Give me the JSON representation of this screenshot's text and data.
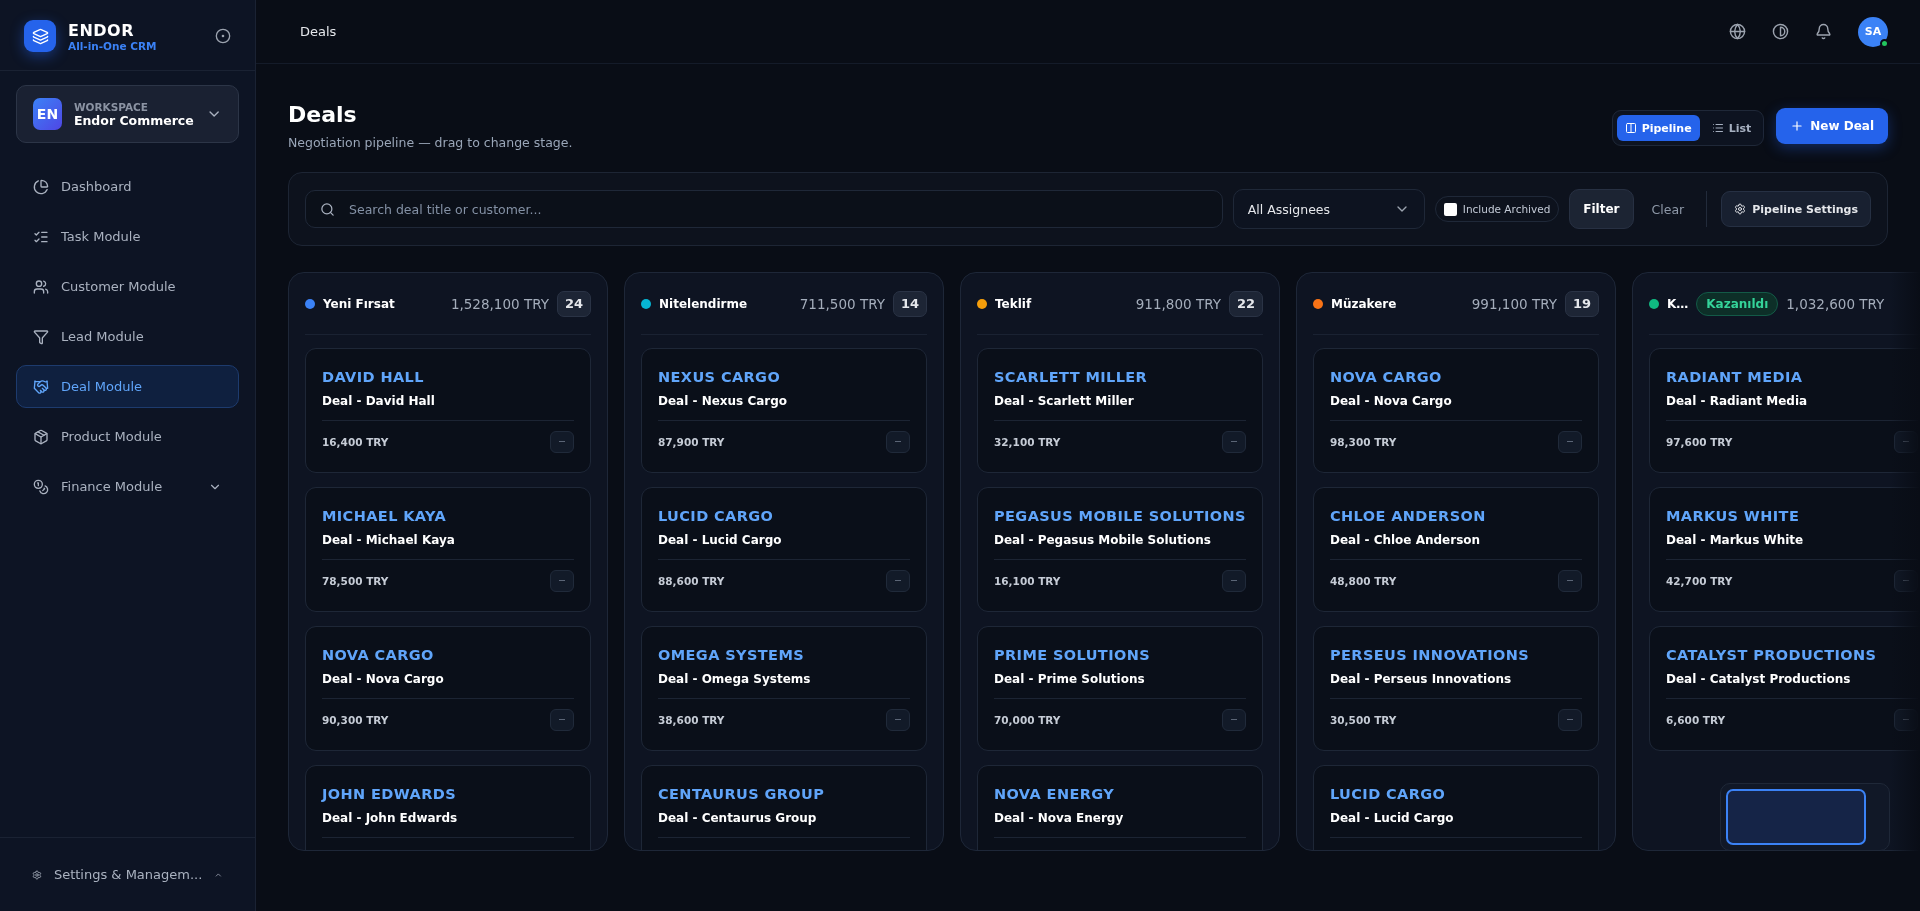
{
  "brand": {
    "name": "ENDOR",
    "tagline": "All-in-One CRM"
  },
  "workspace": {
    "initials": "EN",
    "label": "WORKSPACE",
    "name": "Endor Commerce"
  },
  "sidebar": {
    "items": [
      {
        "label": "Dashboard",
        "kind": "dashboard",
        "selected": false,
        "expandable": false
      },
      {
        "label": "Task Module",
        "kind": "tasks",
        "selected": false,
        "expandable": false
      },
      {
        "label": "Customer Module",
        "kind": "customers",
        "selected": false,
        "expandable": false
      },
      {
        "label": "Lead Module",
        "kind": "leads",
        "selected": false,
        "expandable": false
      },
      {
        "label": "Deal Module",
        "kind": "deals",
        "selected": true,
        "expandable": false
      },
      {
        "label": "Product Module",
        "kind": "products",
        "selected": false,
        "expandable": false
      },
      {
        "label": "Finance Module",
        "kind": "finance",
        "selected": false,
        "expandable": true
      }
    ],
    "footer": "Settings & Managem..."
  },
  "topbar": {
    "breadcrumb": "Deals",
    "avatar": "SA"
  },
  "page": {
    "title": "Deals",
    "subtitle": "Negotiation pipeline — drag to change stage."
  },
  "view_toggle": [
    {
      "label": "Pipeline",
      "kind": "pipeline",
      "selected": true
    },
    {
      "label": "List",
      "kind": "list",
      "selected": false
    }
  ],
  "new_button": "New Deal",
  "filters": {
    "search_placeholder": "Search deal title or customer...",
    "assignee": "All Assignees",
    "include_archived": {
      "label": "Include Archived",
      "checked": false
    },
    "filter": "Filter",
    "clear": "Clear",
    "settings": "Pipeline Settings"
  },
  "columns": [
    {
      "title": "Yeni Fırsat",
      "color": "#3b82f6",
      "total": "1,528,100 TRY",
      "count": "24",
      "cards": [
        {
          "title": "DAVID HALL",
          "deal": "Deal - David Hall",
          "amount": "16,400 TRY"
        },
        {
          "title": "MICHAEL KAYA",
          "deal": "Deal - Michael Kaya",
          "amount": "78,500 TRY"
        },
        {
          "title": "NOVA CARGO",
          "deal": "Deal - Nova Cargo",
          "amount": "90,300 TRY"
        },
        {
          "title": "JOHN EDWARDS",
          "deal": "Deal - John Edwards"
        }
      ]
    },
    {
      "title": "Nitelendirme",
      "color": "#06b6d4",
      "total": "711,500 TRY",
      "count": "14",
      "cards": [
        {
          "title": "NEXUS CARGO",
          "deal": "Deal - Nexus Cargo",
          "amount": "87,900 TRY"
        },
        {
          "title": "LUCID CARGO",
          "deal": "Deal - Lucid Cargo",
          "amount": "88,600 TRY"
        },
        {
          "title": "OMEGA SYSTEMS",
          "deal": "Deal - Omega Systems",
          "amount": "38,600 TRY"
        },
        {
          "title": "CENTAURUS GROUP",
          "deal": "Deal - Centaurus Group"
        }
      ]
    },
    {
      "title": "Teklif",
      "color": "#f59e0b",
      "total": "911,800 TRY",
      "count": "22",
      "cards": [
        {
          "title": "SCARLETT MILLER",
          "deal": "Deal - Scarlett Miller",
          "amount": "32,100 TRY"
        },
        {
          "title": "PEGASUS MOBILE SOLUTIONS",
          "deal": "Deal - Pegasus Mobile Solutions",
          "amount": "16,100 TRY"
        },
        {
          "title": "PRIME SOLUTIONS",
          "deal": "Deal - Prime Solutions",
          "amount": "70,000 TRY"
        },
        {
          "title": "NOVA ENERGY",
          "deal": "Deal - Nova Energy"
        }
      ]
    },
    {
      "title": "Müzakere",
      "color": "#f97316",
      "total": "991,100 TRY",
      "count": "19",
      "cards": [
        {
          "title": "NOVA CARGO",
          "deal": "Deal - Nova Cargo",
          "amount": "98,300 TRY"
        },
        {
          "title": "CHLOE ANDERSON",
          "deal": "Deal - Chloe Anderson",
          "amount": "48,800 TRY"
        },
        {
          "title": "PERSEUS INNOVATIONS",
          "deal": "Deal - Perseus Innovations",
          "amount": "30,500 TRY"
        },
        {
          "title": "LUCID CARGO",
          "deal": "Deal - Lucid Cargo"
        }
      ]
    },
    {
      "title": "K…",
      "badge": "Kazanıldı",
      "color": "#10b981",
      "total": "1,032,600 TRY",
      "cards": [
        {
          "title": "RADIANT MEDIA",
          "deal": "Deal - Radiant Media",
          "amount": "97,600 TRY"
        },
        {
          "title": "MARKUS WHITE",
          "deal": "Deal - Markus White",
          "amount": "42,700 TRY"
        },
        {
          "title": "CATALYST PRODUCTIONS",
          "deal": "Deal - Catalyst Productions",
          "amount": "6,600 TRY"
        }
      ]
    }
  ]
}
